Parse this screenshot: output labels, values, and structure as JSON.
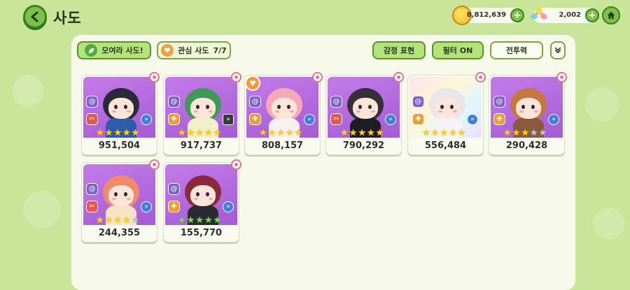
{
  "header": {
    "title": "사도",
    "gold": "8,812,639",
    "flower": "2,002"
  },
  "toolbar": {
    "collect_label": "모여라 사도!",
    "fav_label": "관심 사도",
    "fav_count": "7/7",
    "emotion_label": "감정 표현",
    "filter_label": "필터 ON",
    "sort_label": "전투력"
  },
  "cards": [
    {
      "power": "951,504",
      "bg": "purple",
      "hair": "#2a2b3a",
      "outfit": "#2c5ea8",
      "bottom_icon": "red",
      "arrow": "blue",
      "stars": [
        "gold",
        "gold",
        "gold",
        "gold",
        "gold"
      ],
      "favorite": false
    },
    {
      "power": "917,737",
      "bg": "purple",
      "hair": "#3f9a55",
      "outfit": "#f3efc8",
      "bottom_icon": "orange",
      "arrow": "dark",
      "stars": [
        "gold",
        "gold",
        "gold",
        "gold",
        "gold"
      ],
      "favorite": false
    },
    {
      "power": "808,157",
      "bg": "purple",
      "hair": "#f3a9b8",
      "outfit": "#f6f0f2",
      "bottom_icon": "orange",
      "arrow": "blue",
      "stars": [
        "gold",
        "gold",
        "gold",
        "gold",
        "gold"
      ],
      "favorite": true
    },
    {
      "power": "790,292",
      "bg": "purple",
      "hair": "#35303a",
      "outfit": "#1e1e22",
      "bottom_icon": "red",
      "arrow": "blue",
      "stars": [
        "gold",
        "gold",
        "gold",
        "gold",
        "gold"
      ],
      "favorite": false
    },
    {
      "power": "556,484",
      "bg": "rainbow",
      "hair": "#e8e6ea",
      "outfit": "#f5f3f6",
      "bottom_icon": "orange",
      "arrow": "blue",
      "stars": [
        "gold",
        "gold",
        "gold",
        "gold",
        "gold"
      ],
      "favorite": false
    },
    {
      "power": "290,428",
      "bg": "purple",
      "hair": "#c5773d",
      "outfit": "#8a5a3a",
      "bottom_icon": "orange",
      "arrow": "blue",
      "stars": [
        "gold",
        "gold",
        "gold",
        "empty",
        "empty"
      ],
      "favorite": false
    },
    {
      "power": "244,355",
      "bg": "purple",
      "hair": "#f08a6b",
      "outfit": "#f7e4c4",
      "bottom_icon": "red",
      "arrow": "blue",
      "stars": [
        "gold",
        "gold",
        "gold",
        "gold",
        "empty"
      ],
      "favorite": false
    },
    {
      "power": "155,770",
      "bg": "purple",
      "hair": "#8a2a3a",
      "outfit": "#2a2a33",
      "bottom_icon": "orange",
      "arrow": "blue",
      "stars": [
        "green",
        "green",
        "green",
        "green",
        "green"
      ],
      "favorite": false
    }
  ]
}
